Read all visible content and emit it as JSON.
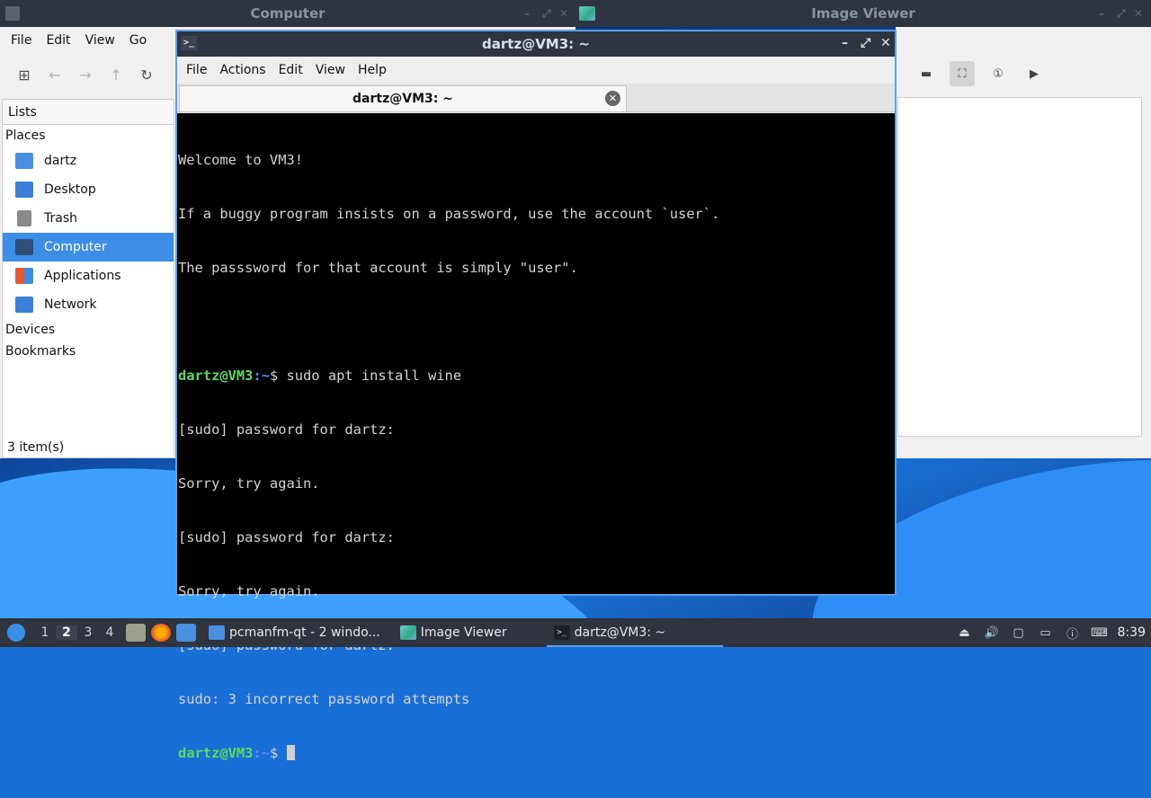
{
  "background_windows": {
    "file_manager_title": "Computer",
    "image_viewer_title": "Image Viewer"
  },
  "file_manager": {
    "menu": [
      "File",
      "Edit",
      "View",
      "Go"
    ],
    "sidebar_header": "Lists",
    "sections": {
      "places": "Places",
      "devices": "Devices",
      "bookmarks": "Bookmarks"
    },
    "places": [
      {
        "label": "dartz",
        "icon": "home-folder-icon",
        "color": "#4a8fe0"
      },
      {
        "label": "Desktop",
        "icon": "desktop-icon",
        "color": "#3b7fd6"
      },
      {
        "label": "Trash",
        "icon": "trash-icon",
        "color": "#8a8a8a"
      },
      {
        "label": "Computer",
        "icon": "computer-icon",
        "color": "#2f4f7a"
      },
      {
        "label": "Applications",
        "icon": "applications-icon",
        "color": "#e25a3a"
      },
      {
        "label": "Network",
        "icon": "network-icon",
        "color": "#3b7fd6"
      }
    ],
    "selected_place": "Computer",
    "status": "3 item(s)"
  },
  "terminal": {
    "title": "dartz@VM3: ~",
    "menu": [
      "File",
      "Actions",
      "Edit",
      "View",
      "Help"
    ],
    "tab_label": "dartz@VM3: ~",
    "prompt_user": "dartz@VM3",
    "prompt_path": ":~",
    "prompt_symbol": "$ ",
    "lines": [
      "Welcome to VM3!",
      "If a buggy program insists on a password, use the account `user`.",
      "The passsword for that account is simply \"user\".",
      ""
    ],
    "command": "sudo apt install wine",
    "output": [
      "[sudo] password for dartz:",
      "Sorry, try again.",
      "[sudo] password for dartz:",
      "Sorry, try again.",
      "[sudo] password for dartz:",
      "sudo: 3 incorrect password attempts"
    ],
    "colors": {
      "prompt_user": "#5fd75f",
      "prompt_path": "#5b8fff",
      "background": "#000000",
      "text": "#d3d3d3"
    }
  },
  "taskbar": {
    "workspaces": [
      "1",
      "2",
      "3",
      "4"
    ],
    "current_workspace": "2",
    "tasks": [
      {
        "label": "pcmanfm-qt - 2 windo...",
        "icon": "folder-icon"
      },
      {
        "label": "Image Viewer",
        "icon": "image-viewer-icon"
      },
      {
        "label": "dartz@VM3: ~",
        "icon": "terminal-icon"
      }
    ],
    "clock": "8:39"
  }
}
